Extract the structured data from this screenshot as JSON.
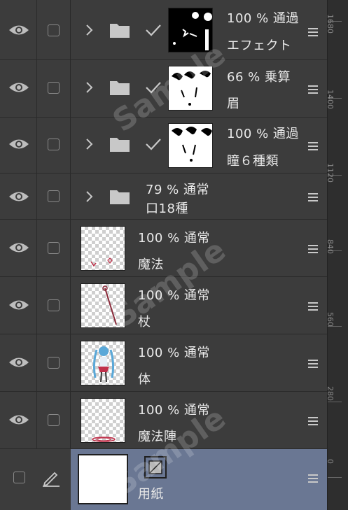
{
  "layers": [
    {
      "opacity_mode": "100 % 通過",
      "name": "エフェクト"
    },
    {
      "opacity_mode": "66 % 乗算",
      "name": "眉"
    },
    {
      "opacity_mode": "100 % 通過",
      "name": "瞳６種類"
    },
    {
      "opacity_mode": "79 % 通常",
      "name": "口18種"
    },
    {
      "opacity_mode": "100 % 通常",
      "name": "魔法"
    },
    {
      "opacity_mode": "100 % 通常",
      "name": "杖"
    },
    {
      "opacity_mode": "100 % 通常",
      "name": "体"
    },
    {
      "opacity_mode": "100 % 通常",
      "name": "魔法陣"
    },
    {
      "opacity_mode": "",
      "name": "用紙"
    }
  ],
  "ruler": {
    "labels": [
      "1680",
      "1400",
      "1120",
      "840",
      "560",
      "280",
      "0"
    ]
  },
  "watermark": "Sample",
  "colors": {
    "panel": "#3c3c3c",
    "selected": "#6a7793",
    "ruler": "#2e2e2e"
  }
}
